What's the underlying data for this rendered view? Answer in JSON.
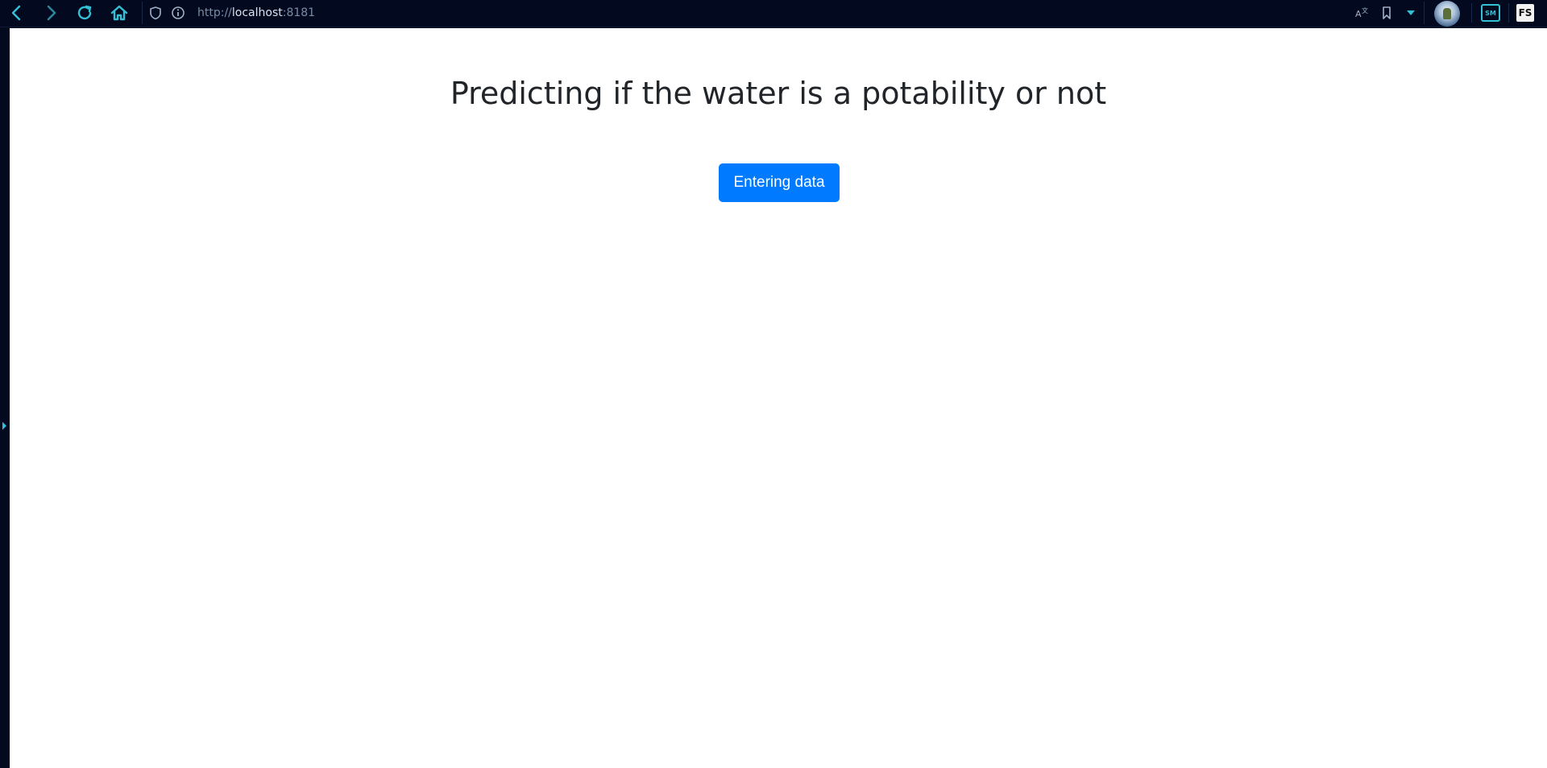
{
  "browser": {
    "url": {
      "scheme": "http://",
      "host": "localhost",
      "port": ":8181"
    },
    "icons": {
      "back": "chevron-left-icon",
      "forward": "chevron-right-icon",
      "reload": "reload-icon",
      "home": "home-icon",
      "shield": "shield-icon",
      "info": "info-icon",
      "translate": "translate-icon",
      "bookmark": "bookmark-icon",
      "menu": "dropdown-arrow-icon"
    },
    "extensions": {
      "sm_label": "SM",
      "fs_label": "FS"
    },
    "accent_color": "#33c0d6"
  },
  "page": {
    "title": "Predicting if the water is a potability or not",
    "button_label": "Entering data",
    "button_color": "#007bff"
  }
}
